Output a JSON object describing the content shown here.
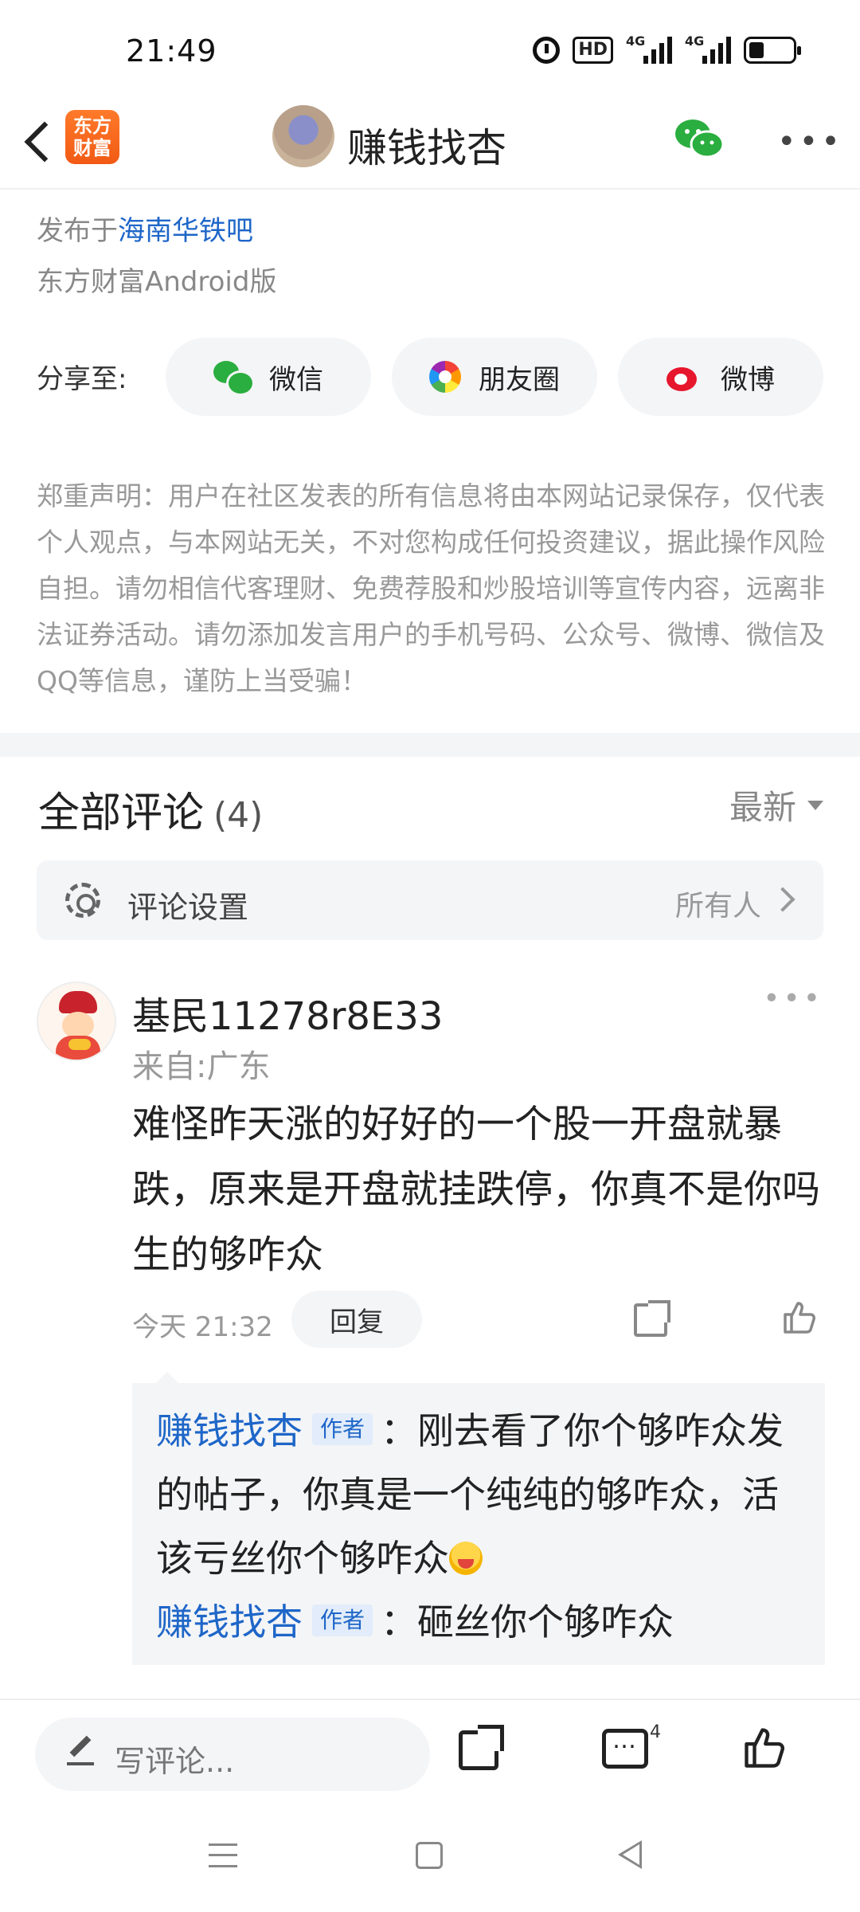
{
  "status_bar": {
    "time": "21:49",
    "hd_label": "HD",
    "signal1_label": "4G",
    "signal2_label": "4G"
  },
  "top_nav": {
    "app_logo_text": "东方财富",
    "title": "赚钱找杏",
    "wechat_icon": "wechat-icon",
    "more_icon": "more-dots-icon"
  },
  "post_meta": {
    "posted_prefix": "发布于",
    "posted_bar": "海南华铁吧",
    "client": "东方财富Android版"
  },
  "share": {
    "label": "分享至:",
    "buttons": [
      {
        "label": "微信",
        "icon": "wechat-icon"
      },
      {
        "label": "朋友圈",
        "icon": "moments-icon"
      },
      {
        "label": "微博",
        "icon": "weibo-icon"
      }
    ]
  },
  "disclaimer": "郑重声明：用户在社区发表的所有信息将由本网站记录保存，仅代表个人观点，与本网站无关，不对您构成任何投资建议，据此操作风险自担。请勿相信代客理财、免费荐股和炒股培训等宣传内容，远离非法证券活动。请勿添加发言用户的手机号码、公众号、微博、微信及QQ等信息，谨防上当受骗！",
  "comments_header": {
    "title": "全部评论",
    "count": "(4)",
    "sort_label": "最新"
  },
  "comment_settings": {
    "label": "评论设置",
    "value": "所有人"
  },
  "comment": {
    "username": "基民11278r8E33",
    "location": "来自:广东",
    "body": "难怪昨天涨的好好的一个股一开盘就暴跌，原来是开盘就挂跌停，你真不是你吗生的够咋众",
    "time": "今天 21:32",
    "reply_label": "回复",
    "replies": [
      {
        "name": "赚钱找杏",
        "tag": "作者",
        "text": "：刚去看了你个够咋众发的帖子，你真是一个纯纯的够咋众，活该亏丝你个够咋众"
      },
      {
        "name": "赚钱找杏",
        "tag": "作者",
        "text": "：砸丝你个够咋众"
      }
    ]
  },
  "bottom_bar": {
    "write_placeholder": "写评论...",
    "comment_badge": "4"
  },
  "colors": {
    "link_blue": "#1e66c8",
    "brand_orange": "#f15a14",
    "wechat_green": "#2aae3f",
    "weibo_red": "#e6162d"
  }
}
